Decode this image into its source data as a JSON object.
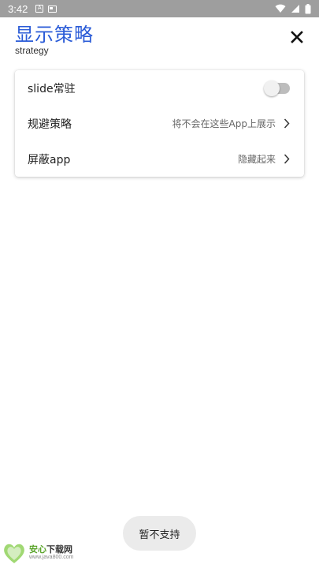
{
  "status_bar": {
    "time": "3:42",
    "notification_letter": "A"
  },
  "header": {
    "title": "显示策略",
    "subtitle": "strategy"
  },
  "settings": {
    "rows": [
      {
        "label": "slide常驻",
        "type": "toggle",
        "toggle_on": false
      },
      {
        "label": "规避策略",
        "value": "将不会在这些App上展示",
        "type": "link"
      },
      {
        "label": "屏蔽app",
        "value": "隐藏起来",
        "type": "link"
      }
    ]
  },
  "toast": {
    "message": "暂不支持"
  },
  "watermark": {
    "title_green": "安心",
    "title_dark": "下载网",
    "url": "www.java800.com"
  },
  "colors": {
    "accent": "#2a5bd7",
    "status_bar": "#9e9e9e",
    "toggle_track_off": "#bdbdbd",
    "watermark_green": "#5aa42a"
  },
  "icons": [
    "wifi-icon",
    "signal-icon",
    "battery-icon",
    "close-icon",
    "chevron-right-icon"
  ]
}
